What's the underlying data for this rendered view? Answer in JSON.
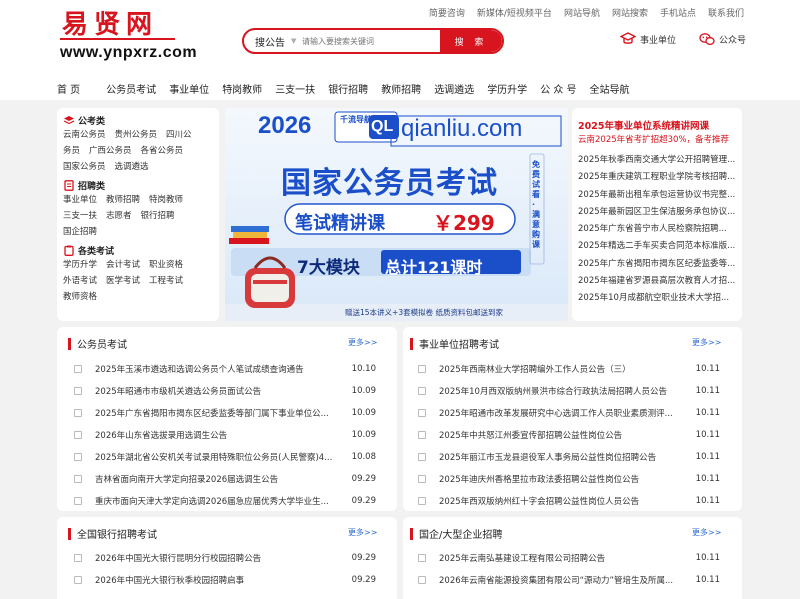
{
  "site": {
    "logo_cn": "易贤网",
    "logo_url": "www.ynpxrz.com"
  },
  "top_links": [
    "简要咨询",
    "新媒体/短视频平台",
    "网站导航",
    "网站搜索",
    "手机站点",
    "联系我们"
  ],
  "search": {
    "scope": "搜公告",
    "placeholder": "请输入要搜索关键词",
    "button": "搜 索"
  },
  "header_right": {
    "institution": "事业单位",
    "official_account": "公众号"
  },
  "nav": [
    "首 页",
    "公务员考试",
    "事业单位",
    "特岗教师",
    "三支一扶",
    "银行招聘",
    "教师招聘",
    "选调遴选",
    "学历升学",
    "公 众 号",
    "全站导航"
  ],
  "sidebar": [
    {
      "title": "公考类",
      "lines": [
        [
          "云南公务员",
          "贵州公务员",
          "四川公"
        ],
        [
          "务员",
          "广西公务员",
          "各省公务员"
        ],
        [
          "国家公务员",
          "选调遴选"
        ]
      ]
    },
    {
      "title": "招聘类",
      "lines": [
        [
          "事业单位",
          "教师招聘",
          "特岗教师"
        ],
        [
          "三支一扶",
          "志愿者",
          "银行招聘"
        ],
        [
          "国企招聘"
        ]
      ]
    },
    {
      "title": "各类考试",
      "lines": [
        [
          "学历升学",
          "会计考试",
          "职业资格"
        ],
        [
          "外语考试",
          "医学考试",
          "工程考试"
        ],
        [
          "教师资格"
        ]
      ]
    }
  ],
  "banner": {
    "year": "2026",
    "brand_cn": "千流导航",
    "brand_mark": "QL",
    "brand_site": "qianliu.com",
    "headline": "国家公务员考试",
    "course": "笔试精讲课",
    "price": "￥299",
    "side_note": "免费试看·满意购课",
    "modules": "7大模块",
    "hours": "总计121课时",
    "footer": "赠送15本讲义+3套模拟卷 纸质资料包邮送到家"
  },
  "announce": {
    "title": "2025年事业单位系统精讲网课",
    "subtitle": "云南2025年省考扩招超30%，备考推荐",
    "items": [
      "2025年秋季西南交通大学公开招聘管理...",
      "2025年重庆建筑工程职业学院考核招聘...",
      "2025年最新出租车承包运营协议书完整...",
      "2025年最新园区卫生保洁服务承包协议...",
      "2025年广东省普宁市人民检察院招聘...",
      "2025年精选二手车买卖合同范本标准版...",
      "2025年广东省揭阳市揭东区纪委监委等...",
      "2025年福建省罗源县高层次教育人才招...",
      "2025年10月成都航空职业技术大学招..."
    ]
  },
  "panels": [
    {
      "title": "公务员考试",
      "more": "更多>>",
      "rows": [
        {
          "t": "2025年玉溪市遴选和选调公务员个人笔试成绩查询通告",
          "d": "10.10"
        },
        {
          "t": "2025年昭通市市级机关遴选公务员面试公告",
          "d": "10.09"
        },
        {
          "t": "2025年广东省揭阳市揭东区纪委监委等部门属下事业单位公...",
          "d": "10.09"
        },
        {
          "t": "2026年山东省选拔录用选调生公告",
          "d": "10.09"
        },
        {
          "t": "2025年湖北省公安机关考试录用特殊职位公务员(人民警察)4...",
          "d": "10.08"
        },
        {
          "t": "吉林省面向南开大学定向招录2026届选调生公告",
          "d": "09.29"
        },
        {
          "t": "重庆市面向天津大学定向选调2026届急应届优秀大学毕业生...",
          "d": "09.29"
        }
      ]
    },
    {
      "title": "事业单位招聘考试",
      "more": "更多>>",
      "rows": [
        {
          "t": "2025年西南林业大学招聘编外工作人员公告（三）",
          "d": "10.11"
        },
        {
          "t": "2025年10月西双版纳州景洪市综合行政执法局招聘人员公告",
          "d": "10.11"
        },
        {
          "t": "2025年昭通市改革发展研究中心选调工作人员职业素质测评...",
          "d": "10.11"
        },
        {
          "t": "2025年中共怒江州委宣传部招聘公益性岗位公告",
          "d": "10.11"
        },
        {
          "t": "2025年丽江市玉龙县退役军人事务局公益性岗位招聘公告",
          "d": "10.11"
        },
        {
          "t": "2025年迪庆州香格里拉市政法委招聘公益性岗位公告",
          "d": "10.11"
        },
        {
          "t": "2025年西双版纳州红十字会招聘公益性岗位人员公告",
          "d": "10.11"
        }
      ]
    },
    {
      "title": "全国银行招聘考试",
      "more": "更多>>",
      "rows": [
        {
          "t": "2026年中国光大银行昆明分行校园招聘公告",
          "d": "09.29"
        },
        {
          "t": "2026年中国光大银行秋季校园招聘启事",
          "d": "09.29"
        }
      ]
    },
    {
      "title": "国企/大型企业招聘",
      "more": "更多>>",
      "rows": [
        {
          "t": "2025年云南弘基建设工程有限公司招聘公告",
          "d": "10.11"
        },
        {
          "t": "2026年云南省能源投资集团有限公司“源动力”管培生及所属...",
          "d": "10.11"
        }
      ]
    }
  ]
}
